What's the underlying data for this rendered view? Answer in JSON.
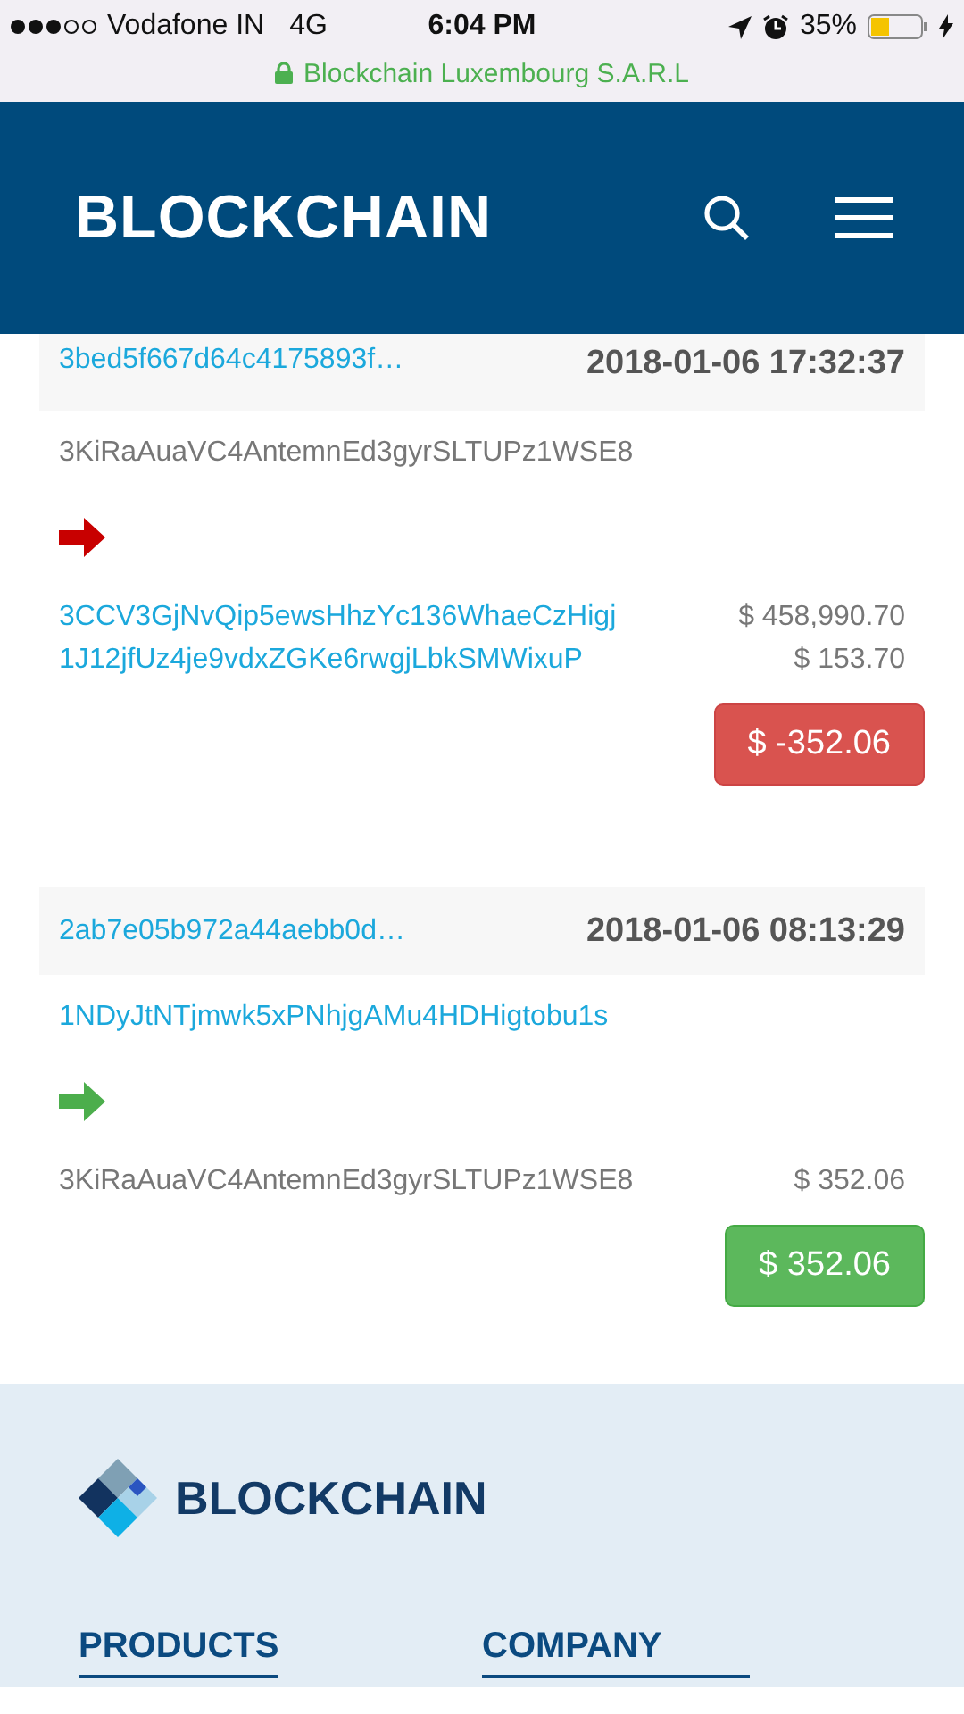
{
  "status_bar": {
    "carrier": "Vodafone IN",
    "network": "4G",
    "time": "6:04 PM",
    "battery": "35%",
    "url": "Blockchain Luxembourg S.A.R.L"
  },
  "header": {
    "logo": "BLOCKCHAIN"
  },
  "transactions": [
    {
      "hash": "3bed5f667d64c4175893f…",
      "time": "2018-01-06 17:32:37",
      "inputs": [
        {
          "address": "3KiRaAuaVC4AntemnEd3gyrSLTUPz1WSE8",
          "linked": false
        }
      ],
      "kind": "out",
      "outputs": [
        {
          "address": "3CCV3GjNvQip5ewsHhzYc136WhaeCzHigj",
          "amount": "$ 458,990.70",
          "linked": true
        },
        {
          "address": "1J12jfUz4je9vdxZGKe6rwgjLbkSMWixuP",
          "amount": "$ 153.70",
          "linked": true
        }
      ],
      "result": {
        "amount": "$ -352.06",
        "kind": "negative"
      }
    },
    {
      "hash": "2ab7e05b972a44aebb0d…",
      "time": "2018-01-06 08:13:29",
      "inputs": [
        {
          "address": "1NDyJtNTjmwk5xPNhjgAMu4HDHigtobu1s",
          "linked": true
        }
      ],
      "kind": "in",
      "outputs": [
        {
          "address": "3KiRaAuaVC4AntemnEd3gyrSLTUPz1WSE8",
          "amount": "$ 352.06",
          "linked": false
        }
      ],
      "result": {
        "amount": "$ 352.06",
        "kind": "positive"
      }
    }
  ],
  "footer": {
    "logo": "BLOCKCHAIN",
    "sections": [
      "PRODUCTS",
      "COMPANY"
    ]
  }
}
